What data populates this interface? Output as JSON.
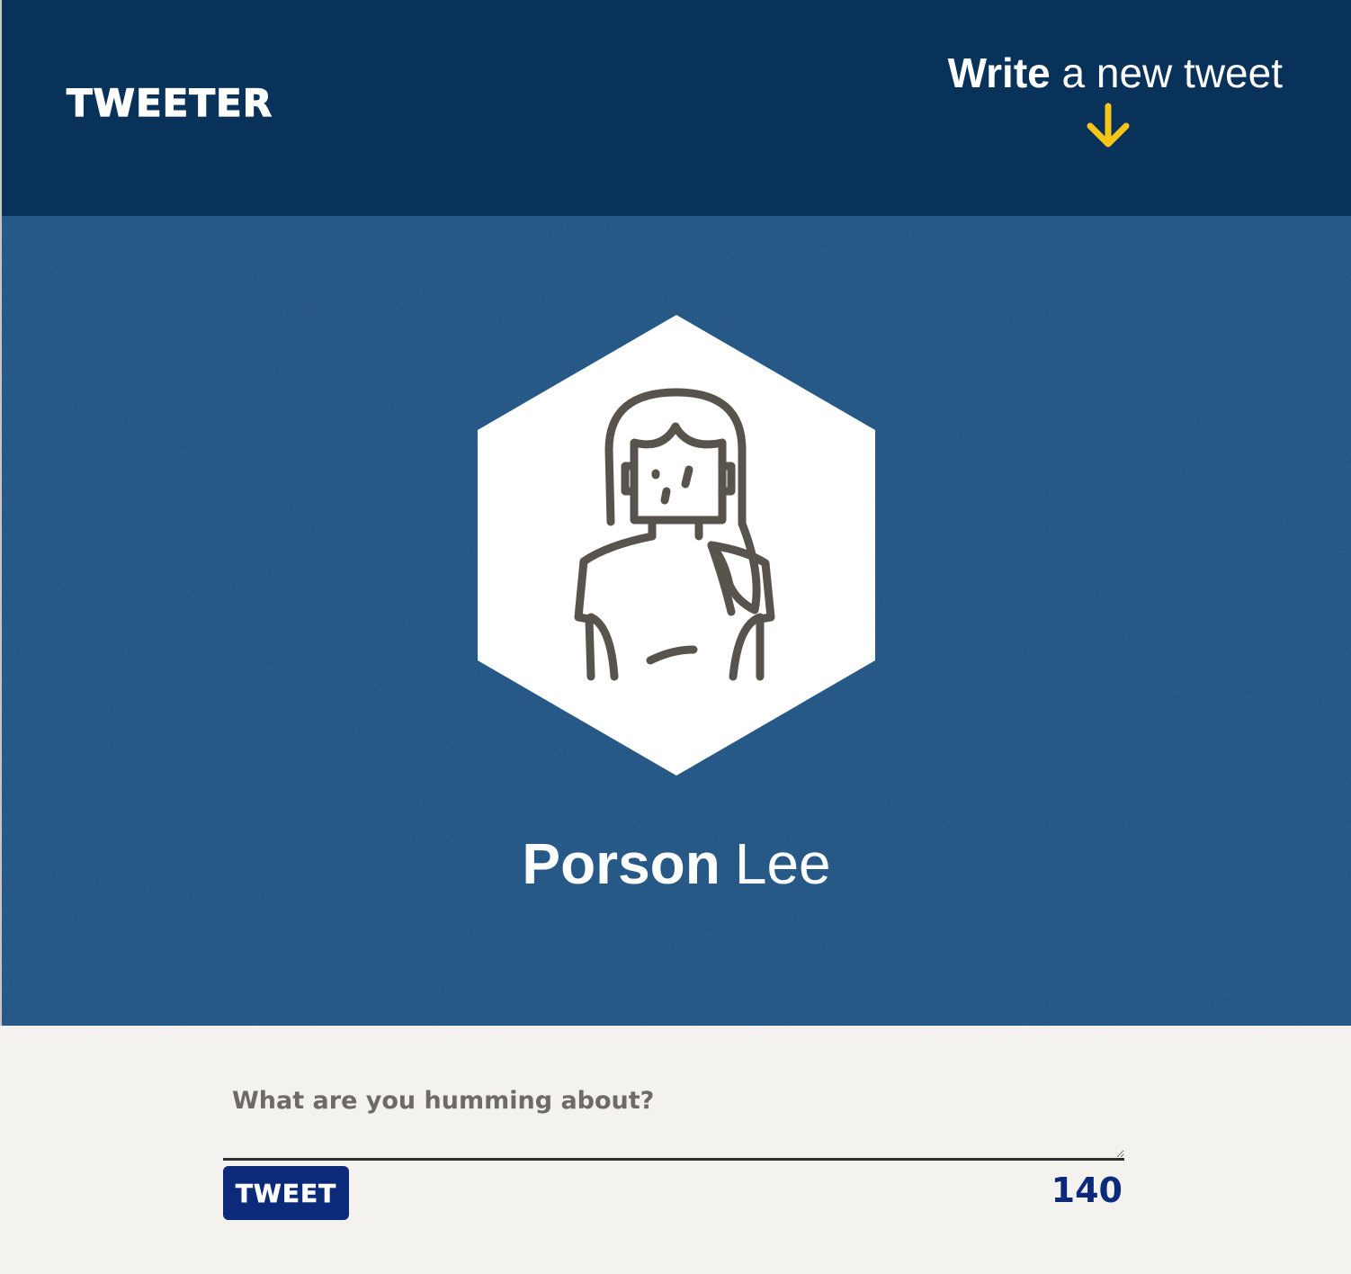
{
  "header": {
    "brand": "TWEETER",
    "compose_link": {
      "strong": "Write",
      "light": "a new tweet"
    },
    "arrow_icon": "arrow-down-icon",
    "arrow_color": "#f5c518"
  },
  "profile": {
    "avatar_icon": "woman-avatar-icon",
    "first_name": "Porson",
    "last_name": "Lee"
  },
  "composer": {
    "placeholder": "What are you humming about?",
    "value": "",
    "button_label": "TWEET",
    "char_counter": "140"
  },
  "colors": {
    "header_bg": "#09325a",
    "banner_bg": "#1d4c7c",
    "page_bg": "#f4f2ee",
    "accent": "#0b2a7a"
  }
}
